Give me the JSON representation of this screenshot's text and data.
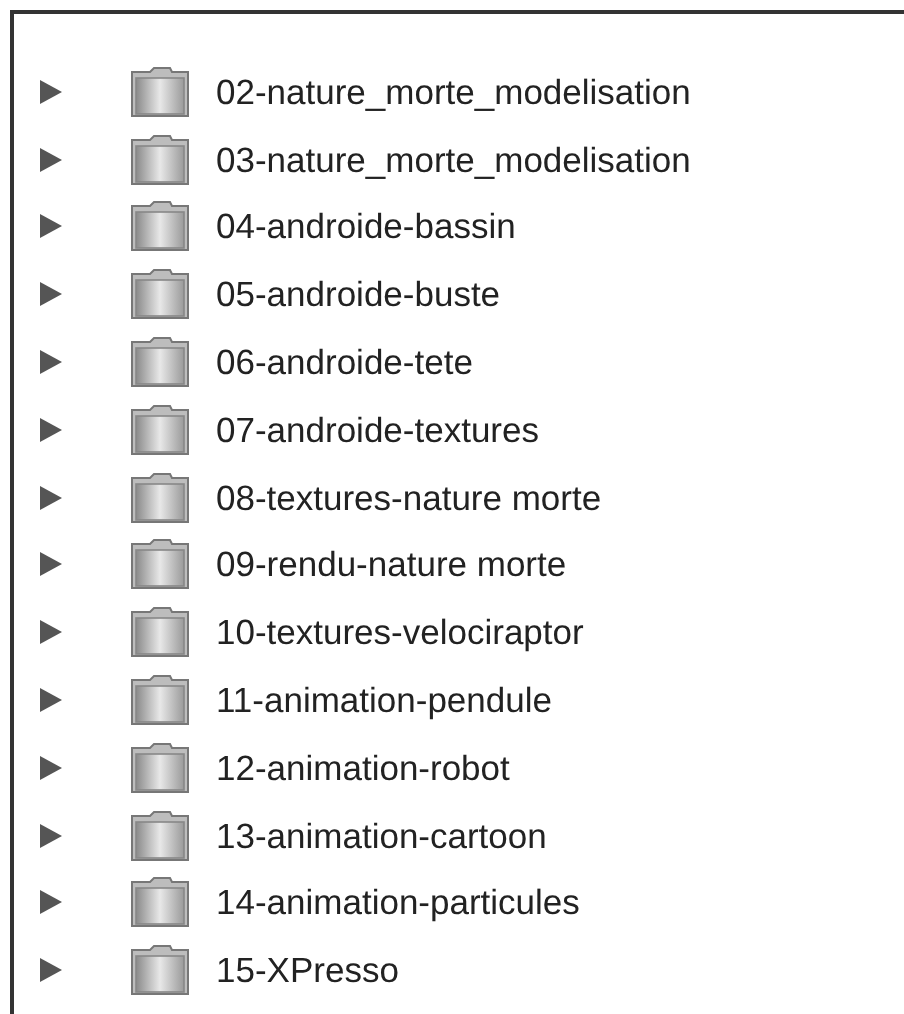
{
  "folders": [
    {
      "name": "02-nature_morte_modelisation",
      "expanded": false
    },
    {
      "name": "03-nature_morte_modelisation",
      "expanded": false
    },
    {
      "name": "04-androide-bassin",
      "expanded": false
    },
    {
      "name": "05-androide-buste",
      "expanded": false
    },
    {
      "name": "06-androide-tete",
      "expanded": false
    },
    {
      "name": "07-androide-textures",
      "expanded": false
    },
    {
      "name": "08-textures-nature morte",
      "expanded": false
    },
    {
      "name": "09-rendu-nature morte",
      "expanded": false
    },
    {
      "name": "10-textures-velociraptor",
      "expanded": false
    },
    {
      "name": "11-animation-pendule",
      "expanded": false
    },
    {
      "name": "12-animation-robot",
      "expanded": false
    },
    {
      "name": "13-animation-cartoon",
      "expanded": false
    },
    {
      "name": "14-animation-particules",
      "expanded": false
    },
    {
      "name": "15-XPresso",
      "expanded": false
    }
  ]
}
